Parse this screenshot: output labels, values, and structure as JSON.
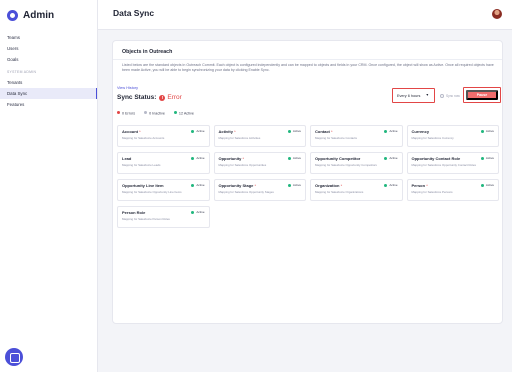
{
  "app": {
    "name": "Admin",
    "logo_icon": "shield-logo-icon"
  },
  "sidebar": {
    "items": [
      {
        "label": "Teams"
      },
      {
        "label": "Users"
      },
      {
        "label": "Goals"
      }
    ],
    "section_label": "SYSTEM ADMIN",
    "admin_items": [
      {
        "label": "Tenants"
      },
      {
        "label": "Data Sync"
      },
      {
        "label": "Features"
      }
    ],
    "active_item": "Data Sync",
    "chat_icon": "chat-icon",
    "version": "v1.0.0"
  },
  "header": {
    "title": "Data Sync",
    "avatar_icon": "user-avatar"
  },
  "card": {
    "title": "Objects in Outreach",
    "description": "Listed below are the standard objects in Outreach Commit. Each object is configured independently and can be mapped to objects and fields in your CRM. Once configured, the object will show as Active. Once all required objects have been made Active, you will be able to begin synchronizing your data by clicking Enable Sync."
  },
  "sync": {
    "view_history": "View History",
    "status_label": "Sync Status:",
    "status_value": "Error",
    "status_color": "#e24646",
    "frequency": "Every 6 hours",
    "sync_now": "Sync now",
    "pause_label": "Pause",
    "counts": [
      {
        "label": "0 Errors",
        "color": "#e24646"
      },
      {
        "label": "0 Inactive",
        "color": "#b6b9c8"
      },
      {
        "label": "12 Active",
        "color": "#21b77e"
      }
    ]
  },
  "objects": [
    {
      "name": "Account",
      "required": "*",
      "desc": "Mapping for Salesforce Accounts",
      "status": "Active"
    },
    {
      "name": "Activity",
      "required": "*",
      "desc": "Mapping for Salesforce Activities",
      "status": "Active"
    },
    {
      "name": "Contact",
      "required": "*",
      "desc": "Mapping for Salesforce Contacts",
      "status": "Active"
    },
    {
      "name": "Currency",
      "required": "",
      "desc": "Mapping for Salesforce Currency",
      "status": "Active"
    },
    {
      "name": "Lead",
      "required": "",
      "desc": "Mapping for Salesforce Leads",
      "status": "Active"
    },
    {
      "name": "Opportunity",
      "required": "*",
      "desc": "Mapping for Salesforce Opportunities",
      "status": "Active"
    },
    {
      "name": "Opportunity Competitor",
      "required": "",
      "desc": "Mapping for Salesforce Opportunity Competitors",
      "status": "Active"
    },
    {
      "name": "Opportunity Contact Role",
      "required": "",
      "desc": "Mapping for Salesforce Opportunity Contact Roles",
      "status": "Active"
    },
    {
      "name": "Opportunity Line Item",
      "required": "",
      "desc": "Mapping for Salesforce Opportunity Line Items",
      "status": "Active"
    },
    {
      "name": "Opportunity Stage",
      "required": "*",
      "desc": "Mapping for Salesforce Opportunity Stages",
      "status": "Active"
    },
    {
      "name": "Organization",
      "required": "*",
      "desc": "Mapping for Salesforce Organizations",
      "status": "Active"
    },
    {
      "name": "Person",
      "required": "*",
      "desc": "Mapping for Salesforce Persons",
      "status": "Active"
    },
    {
      "name": "Person Role",
      "required": "",
      "desc": "Mapping for Salesforce Person Roles",
      "status": "Active"
    }
  ]
}
